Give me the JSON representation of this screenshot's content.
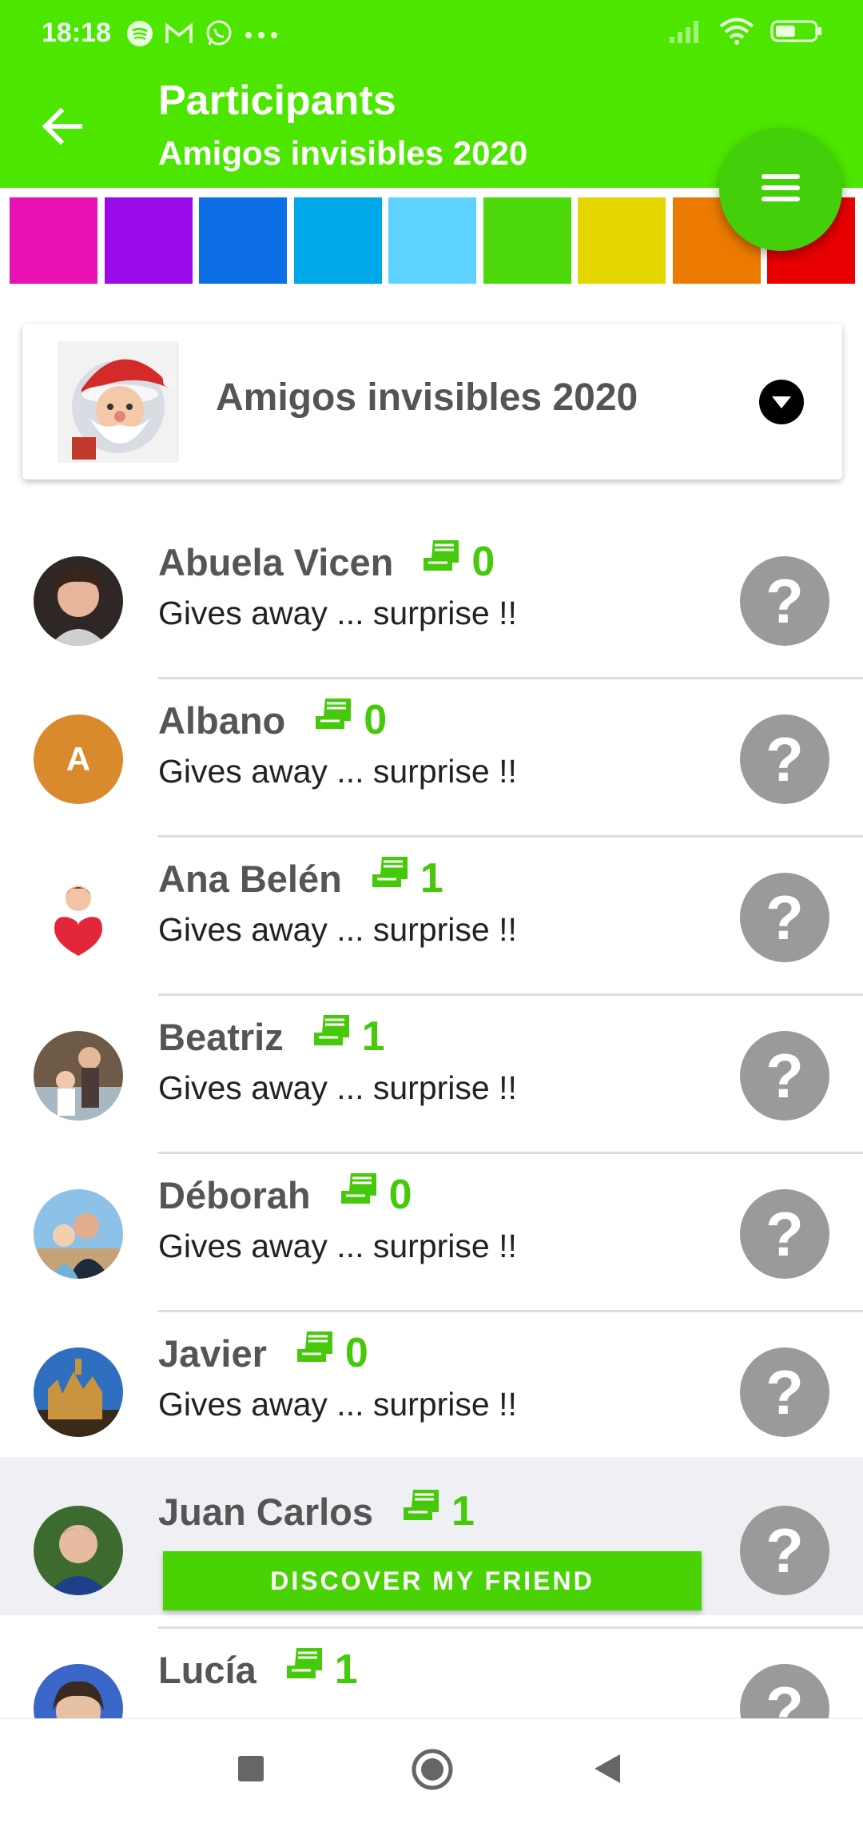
{
  "status_bar": {
    "time": "18:18",
    "notification_icons": [
      "spotify-icon",
      "gmail-icon",
      "whatsapp-icon",
      "more-icon"
    ],
    "system_icons": [
      "signal-icon",
      "wifi-icon",
      "battery-icon"
    ]
  },
  "app_bar": {
    "title": "Participants",
    "subtitle": "Amigos invisibles 2020",
    "background_color": "#4ce600"
  },
  "palette": [
    "#e812b4",
    "#9b0ae8",
    "#0c6fe6",
    "#00a8e8",
    "#5fd3ff",
    "#4cd80a",
    "#e6d600",
    "#ec7a00",
    "#e80000"
  ],
  "group": {
    "name": "Amigos invisibles 2020"
  },
  "participants": [
    {
      "name": "Abuela Vicen",
      "count": "0",
      "description": "Gives away ... surprise !!",
      "avatar": "photo"
    },
    {
      "name": "Albano",
      "count": "0",
      "description": "Gives away ... surprise !!",
      "avatar": "initial",
      "initial": "A"
    },
    {
      "name": "Ana Belén",
      "count": "1",
      "description": "Gives away ... surprise !!",
      "avatar": "cartoon"
    },
    {
      "name": "Beatriz",
      "count": "1",
      "description": "Gives away ... surprise !!",
      "avatar": "photo"
    },
    {
      "name": "Déborah",
      "count": "0",
      "description": "Gives away ... surprise !!",
      "avatar": "photo"
    },
    {
      "name": "Javier",
      "count": "0",
      "description": "Gives away ... surprise !!",
      "avatar": "photo"
    },
    {
      "name": "Juan Carlos",
      "count": "1",
      "action_label": "DISCOVER MY FRIEND",
      "avatar": "photo",
      "highlighted": true
    },
    {
      "name": "Lucía",
      "count": "1",
      "avatar": "photo"
    }
  ],
  "question_mark": "?",
  "accent_color": "#46c90a"
}
